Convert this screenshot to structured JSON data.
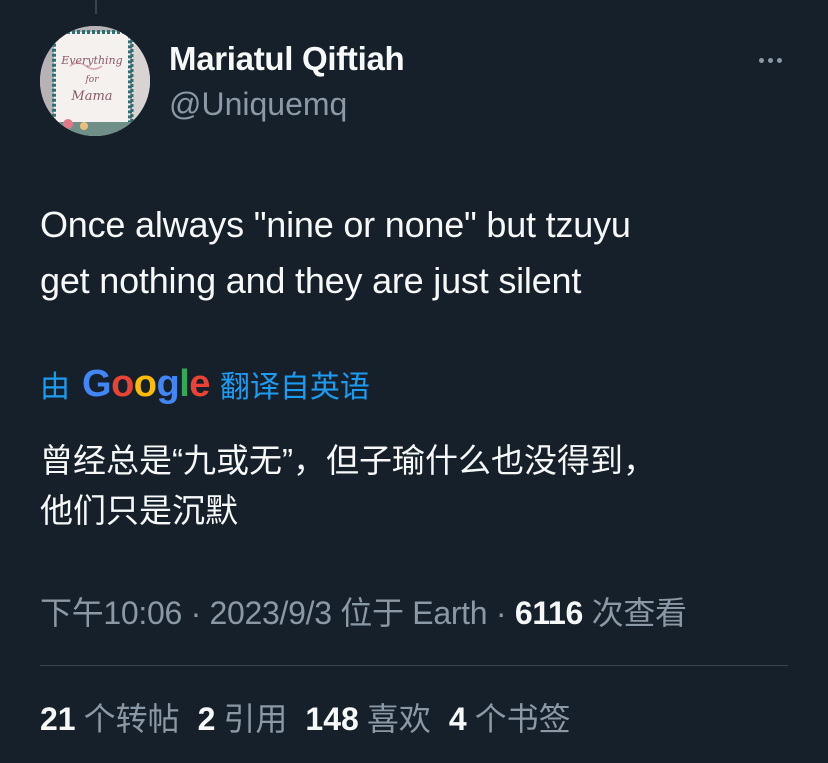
{
  "author": {
    "display_name": "Mariatul Qiftiah",
    "handle": "@Uniquemq",
    "avatar_text": {
      "line1": "Everything",
      "line2": "for",
      "line3": "Mama"
    }
  },
  "tweet": {
    "text_line1": "Once always \"nine or none\" but tzuyu",
    "text_line2": "get nothing and they are just silent"
  },
  "translation": {
    "prefix": "由",
    "provider": "Google",
    "suffix": "翻译自英语",
    "text_line1": "曾经总是“九或无”，但子瑜什么也没得到，",
    "text_line2": "他们只是沉默"
  },
  "meta": {
    "time": "下午10:06",
    "separator": " · ",
    "date": "2023/9/3",
    "location": "位于 Earth",
    "views_count": "6116",
    "views_label": "次查看"
  },
  "stats": {
    "retweets_count": "21",
    "retweets_label": "个转帖",
    "quotes_count": "2",
    "quotes_label": "引用",
    "likes_count": "148",
    "likes_label": "喜欢",
    "bookmarks_count": "4",
    "bookmarks_label": "个书签"
  },
  "icons": {
    "more": "more-horizontal-icon"
  },
  "colors": {
    "background": "#15202b",
    "text_primary": "#f7f9f9",
    "text_secondary": "#8b98a5",
    "link": "#1d9bf0",
    "divider": "#38444d",
    "google_blue": "#4285f4",
    "google_red": "#ea4335",
    "google_yellow": "#fbbc05",
    "google_green": "#34a853"
  }
}
